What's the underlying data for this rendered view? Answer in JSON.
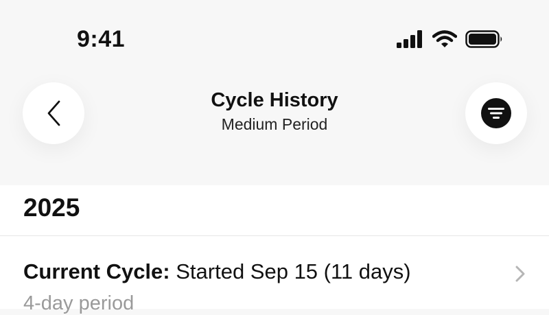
{
  "status_bar": {
    "time": "9:41",
    "icons": [
      "cellular-signal-icon",
      "wifi-icon",
      "battery-icon"
    ]
  },
  "nav": {
    "title": "Cycle History",
    "subtitle": "Medium Period",
    "back_icon": "chevron-left-icon",
    "filter_icon": "filter-icon"
  },
  "section": {
    "year": "2025",
    "rows": [
      {
        "label": "Current Cycle:",
        "value": "Started Sep 15 (11 days)",
        "detail": "4-day period",
        "icon": "chevron-right-icon"
      }
    ]
  },
  "colors": {
    "header_background": "#f7f7f7",
    "content_background": "#ffffff",
    "primary_text": "#111111",
    "secondary_text": "#9a9a9a"
  }
}
